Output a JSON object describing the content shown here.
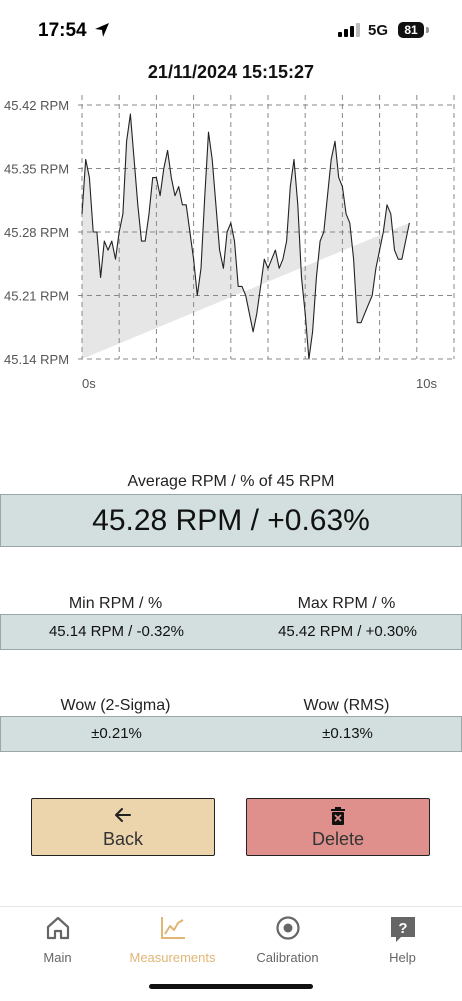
{
  "status_bar": {
    "time": "17:54",
    "network": "5G",
    "battery": "81"
  },
  "measurement": {
    "datetime": "21/11/2024 15:15:27"
  },
  "chart_data": {
    "type": "area",
    "ylabel_unit": "RPM",
    "y_ticks": [
      "45.42 RPM",
      "45.35 RPM",
      "45.28 RPM",
      "45.21 RPM",
      "45.14 RPM"
    ],
    "y_tick_values": [
      45.42,
      45.35,
      45.28,
      45.21,
      45.14
    ],
    "x_ticks": [
      "0s",
      "10s"
    ],
    "x_range": [
      0,
      10
    ],
    "ylim": [
      45.14,
      45.42
    ],
    "grid": true,
    "colors": {
      "line": "#222222",
      "fill": "#e6e6e6",
      "grid": "#888888"
    },
    "x": [
      0,
      0.1,
      0.2,
      0.3,
      0.4,
      0.5,
      0.6,
      0.7,
      0.8,
      0.9,
      1.0,
      1.1,
      1.2,
      1.3,
      1.4,
      1.5,
      1.6,
      1.7,
      1.8,
      1.9,
      2.0,
      2.1,
      2.2,
      2.3,
      2.4,
      2.5,
      2.6,
      2.7,
      2.8,
      2.9,
      3.0,
      3.1,
      3.2,
      3.3,
      3.4,
      3.5,
      3.6,
      3.7,
      3.8,
      3.9,
      4.0,
      4.1,
      4.2,
      4.3,
      4.4,
      4.5,
      4.6,
      4.7,
      4.8,
      4.9,
      5.0,
      5.1,
      5.2,
      5.3,
      5.4,
      5.5,
      5.6,
      5.7,
      5.8,
      5.9,
      6.0,
      6.1,
      6.2,
      6.3,
      6.4,
      6.5,
      6.6,
      6.7,
      6.8,
      6.9,
      7.0,
      7.1,
      7.2,
      7.3,
      7.4,
      7.5,
      7.6,
      7.7,
      7.8,
      7.9,
      8.0,
      8.1,
      8.2,
      8.3,
      8.4,
      8.5,
      8.6,
      8.7,
      8.8,
      8.9,
      9.0,
      9.1,
      9.2,
      9.3,
      9.4,
      9.5,
      9.6,
      9.7,
      9.8,
      9.9,
      10.0
    ],
    "values": [
      45.3,
      45.36,
      45.34,
      45.28,
      45.28,
      45.23,
      45.27,
      45.26,
      45.27,
      45.25,
      45.28,
      45.3,
      45.38,
      45.41,
      45.36,
      45.31,
      45.27,
      45.27,
      45.3,
      45.34,
      45.34,
      45.32,
      45.35,
      45.37,
      45.34,
      45.32,
      45.33,
      45.31,
      45.31,
      45.28,
      45.25,
      45.21,
      45.24,
      45.32,
      45.39,
      45.36,
      45.31,
      45.26,
      45.24,
      45.28,
      45.29,
      45.27,
      45.22,
      45.22,
      45.21,
      45.19,
      45.17,
      45.19,
      45.22,
      45.25,
      45.24,
      45.25,
      45.26,
      45.24,
      45.25,
      45.27,
      45.33,
      45.36,
      45.31,
      45.23,
      45.19,
      45.14,
      45.17,
      45.23,
      45.27,
      45.28,
      45.32,
      45.36,
      45.38,
      45.34,
      45.33,
      45.3,
      45.29,
      45.25,
      45.18,
      45.18,
      45.19,
      45.2,
      45.21,
      45.24,
      45.26,
      45.28,
      45.31,
      45.3,
      45.26,
      45.25,
      45.25,
      45.27,
      45.29
    ]
  },
  "average": {
    "label": "Average RPM / % of 45 RPM",
    "value": "45.28 RPM / +0.63%"
  },
  "min_max": {
    "min_label": "Min RPM / %",
    "max_label": "Max RPM / %",
    "min_value": "45.14 RPM / -0.32%",
    "max_value": "45.42 RPM / +0.30%"
  },
  "wow": {
    "sigma_label": "Wow (2-Sigma)",
    "rms_label": "Wow (RMS)",
    "sigma_value": "±0.21%",
    "rms_value": "±0.13%"
  },
  "buttons": {
    "back": "Back",
    "delete": "Delete"
  },
  "tabs": [
    {
      "label": "Main",
      "icon": "home-icon",
      "active": false
    },
    {
      "label": "Measurements",
      "icon": "chart-line-icon",
      "active": true
    },
    {
      "label": "Calibration",
      "icon": "target-icon",
      "active": false
    },
    {
      "label": "Help",
      "icon": "question-bubble-icon",
      "active": false
    }
  ]
}
